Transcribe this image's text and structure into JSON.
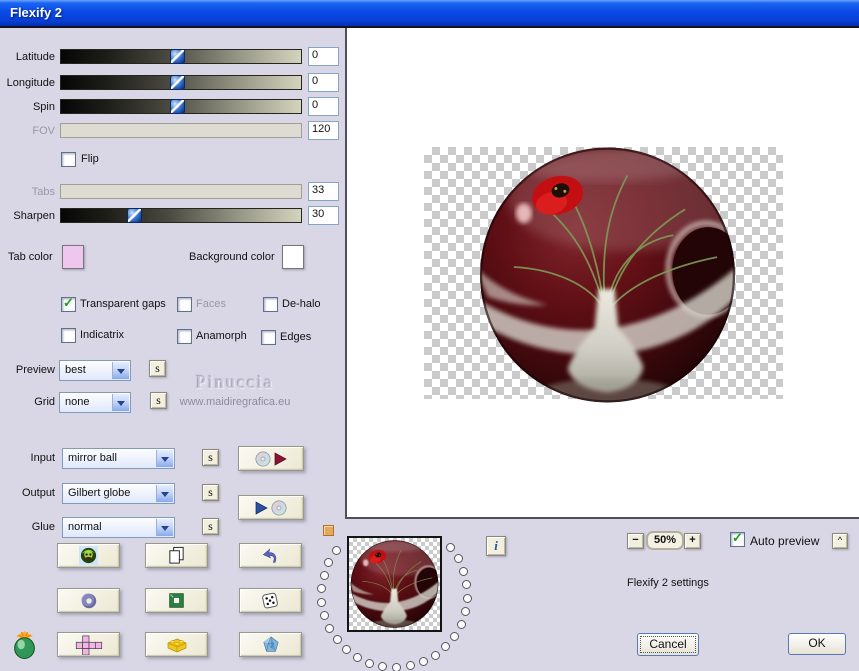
{
  "window": {
    "title": "Flexify 2"
  },
  "sliders": [
    {
      "label": "Latitude",
      "value": "0"
    },
    {
      "label": "Longitude",
      "value": "0"
    },
    {
      "label": "Spin",
      "value": "0"
    },
    {
      "label": "FOV",
      "value": "120"
    },
    {
      "label": "Tabs",
      "value": "33"
    },
    {
      "label": "Sharpen",
      "value": "30"
    }
  ],
  "flip": {
    "label": "Flip",
    "checked": false
  },
  "color_pickers": {
    "tab": {
      "label": "Tab color",
      "color": "#eec6ee"
    },
    "background": {
      "label": "Background color",
      "color": "#ffffff"
    }
  },
  "options": {
    "transparent_gaps": {
      "label": "Transparent gaps",
      "checked": true,
      "disabled": false
    },
    "faces": {
      "label": "Faces",
      "checked": false,
      "disabled": true
    },
    "dehalo": {
      "label": "De-halo",
      "checked": false,
      "disabled": false
    },
    "indicatrix": {
      "label": "Indicatrix",
      "checked": false,
      "disabled": false
    },
    "anamorph": {
      "label": "Anamorph",
      "checked": false,
      "disabled": false
    },
    "edges": {
      "label": "Edges",
      "checked": false,
      "disabled": false
    }
  },
  "dropdowns": {
    "preview": {
      "label": "Preview",
      "value": "best"
    },
    "grid": {
      "label": "Grid",
      "value": "none"
    },
    "input": {
      "label": "Input",
      "value": "mirror ball"
    },
    "output": {
      "label": "Output",
      "value": "Gilbert globe"
    },
    "glue": {
      "label": "Glue",
      "value": "normal"
    }
  },
  "s_button": "s",
  "watermark": {
    "name": "Pinuccia",
    "url": "www.maidiregrafica.eu"
  },
  "icons": {
    "grid_buttons": [
      "sphere-face",
      "copy-pages",
      "undo-arrow",
      "torus",
      "green-frame",
      "dice",
      "cube-net",
      "lego-brick",
      "polyhedron"
    ],
    "preset_save": "cd-with-red-arrow",
    "preset_apply": "blue-arrow-with-cd",
    "logo": "flaming-pear",
    "info": "info"
  },
  "footer": {
    "info": "i",
    "zoom_out": "−",
    "zoom_level": "50%",
    "zoom_in": "+",
    "auto_preview": {
      "label": "Auto preview",
      "checked": true
    },
    "collapse": "^",
    "status": "Flexify 2 settings",
    "cancel": "Cancel",
    "ok": "OK"
  }
}
